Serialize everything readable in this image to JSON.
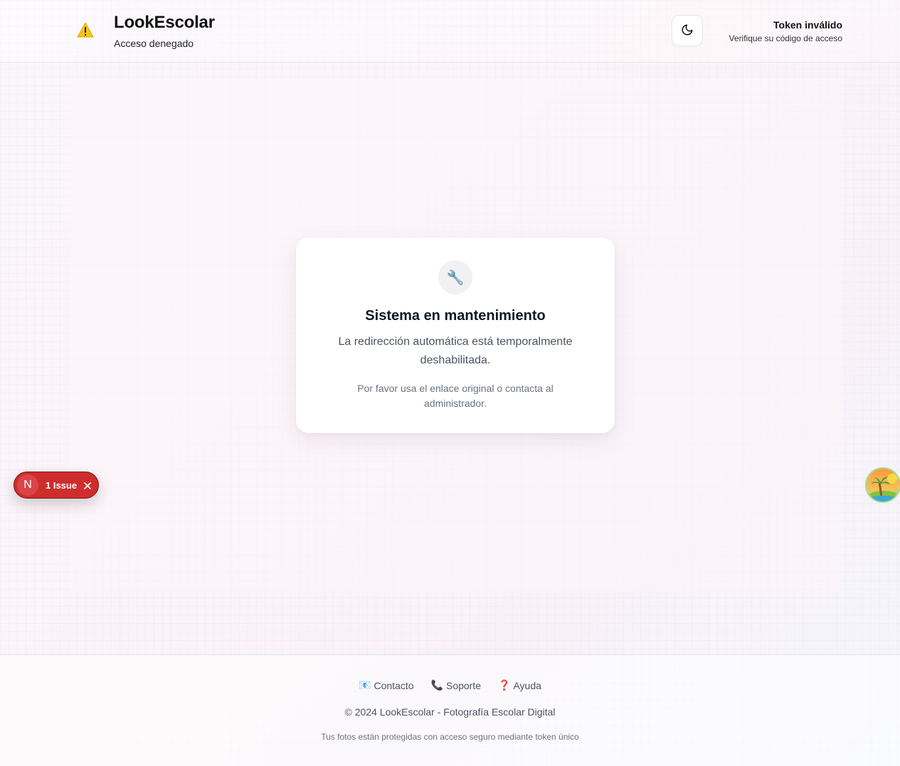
{
  "header": {
    "brand_title": "LookEscolar",
    "brand_subtitle": "Acceso denegado",
    "warning_icon": "warning-icon",
    "theme_toggle_icon": "moon-icon",
    "status_title": "Token inválido",
    "status_subtitle": "Verifique su código de acceso"
  },
  "card": {
    "icon": "wrench-icon",
    "icon_glyph": "🔧",
    "title": "Sistema en mantenimiento",
    "text": "La redirección automática está temporalmente deshabilitada.",
    "note": "Por favor usa el enlace original o contacta al administrador."
  },
  "issue_badge": {
    "logo_letter": "N",
    "label": "1 Issue"
  },
  "footer": {
    "links": [
      {
        "glyph": "📧",
        "label": "Contacto"
      },
      {
        "glyph": "📞",
        "label": "Soporte"
      },
      {
        "glyph": "❓",
        "label": "Ayuda"
      }
    ],
    "copyright": "© 2024 LookEscolar - Fotografía Escolar Digital",
    "protect_note": "Tus fotos están protegidas con acceso seguro mediante token único"
  },
  "colors": {
    "issue_red": "#cf2d2d",
    "warning_yellow": "#f5c518",
    "text_dark": "#111827",
    "text_muted": "#4b5563"
  }
}
